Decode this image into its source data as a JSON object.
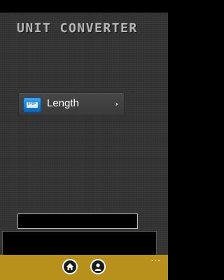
{
  "app": {
    "title": "UNIT CONVERTER"
  },
  "categories": [
    {
      "label": "Length",
      "icon": "ruler-icon",
      "chevron": "›"
    }
  ],
  "converter": {
    "input_value": "",
    "result_value": ""
  },
  "app_bar": {
    "buttons": [
      {
        "name": "home",
        "icon": "home-icon"
      },
      {
        "name": "profile",
        "icon": "person-icon"
      }
    ],
    "more_label": "...",
    "color": "#b8901c"
  },
  "colors": {
    "accent_blue": "#1a82d8",
    "app_bar": "#b8901c",
    "background": "#333333"
  }
}
